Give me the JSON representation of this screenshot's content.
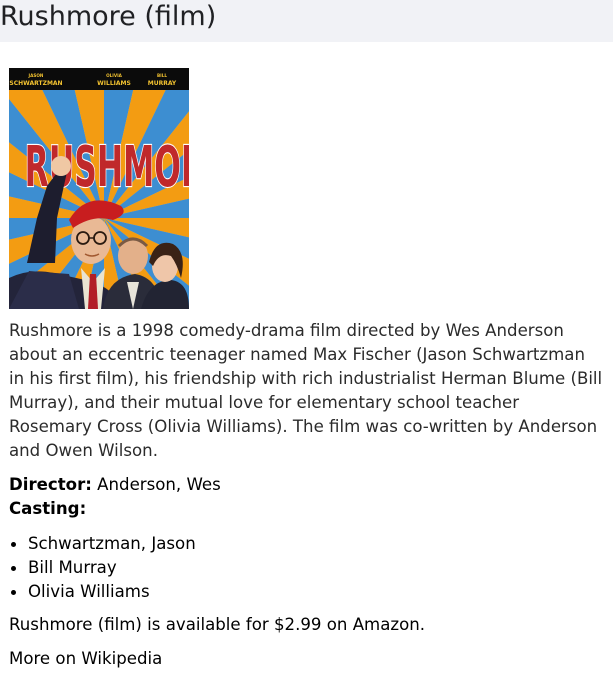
{
  "page": {
    "title": "Rushmore (film)"
  },
  "poster": {
    "cast_top": [
      {
        "first": "JASON",
        "last": "SCHWARTZMAN"
      },
      {
        "first": "OLIVIA",
        "last": "WILLIAMS"
      },
      {
        "first": "BILL",
        "last": "MURRAY"
      }
    ],
    "logo_text": "RUSHMORE",
    "colors": {
      "ray_orange": "#f39c12",
      "ray_blue": "#3d8ed1",
      "logo_red": "#c0292b"
    }
  },
  "description": "Rushmore is a 1998 comedy-drama film directed by Wes Anderson about an eccentric teenager named Max Fischer (Jason Schwartzman in his first film), his friendship with rich industrialist Herman Blume (Bill Murray), and their mutual love for elementary school teacher Rosemary Cross (Olivia Williams). The film was co-written by Anderson and Owen Wilson.",
  "director": {
    "label": "Director:",
    "value": "Anderson, Wes"
  },
  "casting": {
    "label": "Casting:",
    "members": [
      "Schwartzman, Jason",
      "Bill Murray",
      "Olivia Williams"
    ]
  },
  "availability": "Rushmore (film) is available for $2.99 on Amazon.",
  "more_link": "More on Wikipedia"
}
